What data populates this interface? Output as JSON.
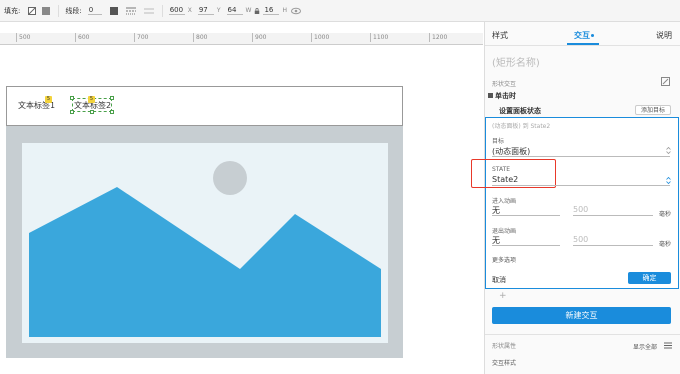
{
  "toolbar": {
    "fill_label": "填充:",
    "stroke_label": "线段:",
    "stroke_value": "0",
    "x_value": "600",
    "x_label": "X",
    "y_value": "97",
    "y_label": "Y",
    "w_value": "64",
    "w_label": "W",
    "h_value": "16",
    "h_label": "H"
  },
  "ruler": {
    "ticks": [
      "500",
      "600",
      "700",
      "800",
      "900",
      "1000",
      "1100",
      "1200"
    ]
  },
  "canvas": {
    "tab1_label": "文本标签1",
    "tab2_label": "文本标签2",
    "badge1": "5",
    "badge2": "5"
  },
  "panel": {
    "tab_style": "样式",
    "tab_interaction": "交互",
    "tab_notes": "说明",
    "shape_name_placeholder": "(矩形名称)",
    "shape_interaction_title": "形状交互",
    "event_label": "单击时",
    "action_label": "设置面板状态",
    "add_target_button": "添加目标",
    "summary": "(动态面板) 到 State2",
    "target_label": "目标",
    "target_value": "(动态面板)",
    "state_label": "STATE",
    "state_value": "State2",
    "anim_in_label": "进入动画",
    "anim_in_value": "无",
    "anim_in_ms": "500",
    "anim_in_unit": "毫秒",
    "anim_out_label": "退出动画",
    "anim_out_value": "无",
    "anim_out_ms": "500",
    "anim_out_unit": "毫秒",
    "more_options": "更多选项",
    "cancel_button": "取消",
    "ok_button": "确定",
    "plus": "+",
    "new_interaction_button": "新建交互",
    "shape_props_label": "形状属性",
    "show_all": "显示全部",
    "interaction_style": "交互样式"
  },
  "colors": {
    "accent": "#1a8cdc",
    "highlight": "#e8392a",
    "mountain": "#3aa7dc",
    "sun": "#c7ced2"
  }
}
